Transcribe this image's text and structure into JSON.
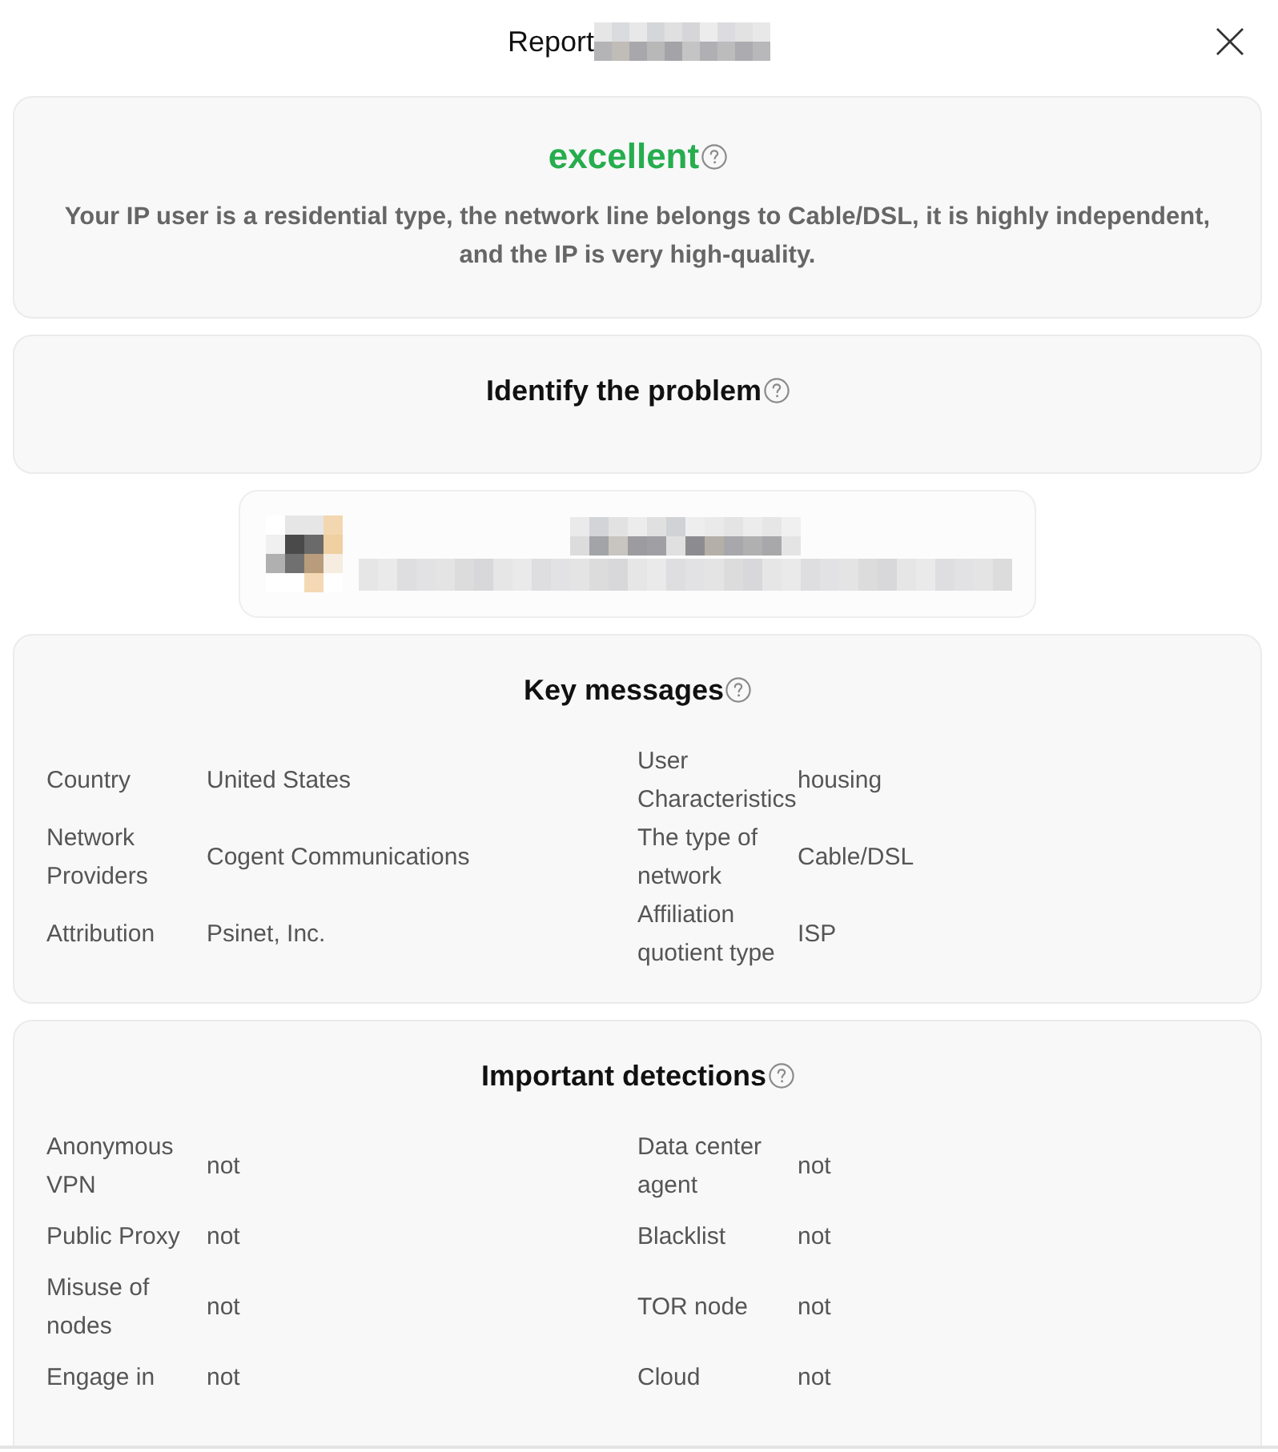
{
  "header": {
    "title": "Report",
    "title_redacted": true
  },
  "rating": {
    "grade": "excellent",
    "description": "Your IP user is a residential type, the network line belongs to Cable/DSL, it is highly independent, and the IP is very high-quality."
  },
  "problem": {
    "title": "Identify the problem"
  },
  "ip_card": {
    "redacted": true
  },
  "key_messages": {
    "title": "Key messages",
    "rows": [
      [
        {
          "label": "Country",
          "value": "United States"
        },
        {
          "label": "User Characteristics",
          "value": "housing"
        }
      ],
      [
        {
          "label": "Network Providers",
          "value": "Cogent Communications"
        },
        {
          "label": "The type of network",
          "value": "Cable/DSL"
        }
      ],
      [
        {
          "label": "Attribution",
          "value": "Psinet, Inc."
        },
        {
          "label": "Affiliation quotient type",
          "value": "ISP"
        }
      ]
    ]
  },
  "detections": {
    "title": "Important detections",
    "rows": [
      [
        {
          "label": "Anonymous VPN",
          "value": "not"
        },
        {
          "label": "Data center agent",
          "value": "not"
        }
      ],
      [
        {
          "label": "Public Proxy",
          "value": "not"
        },
        {
          "label": "Blacklist",
          "value": "not"
        }
      ],
      [
        {
          "label": "Misuse of nodes",
          "value": "not"
        },
        {
          "label": "TOR node",
          "value": "not"
        }
      ],
      [
        {
          "label": "Engage in",
          "value": "not"
        },
        {
          "label": "Cloud",
          "value": "not"
        }
      ]
    ]
  }
}
